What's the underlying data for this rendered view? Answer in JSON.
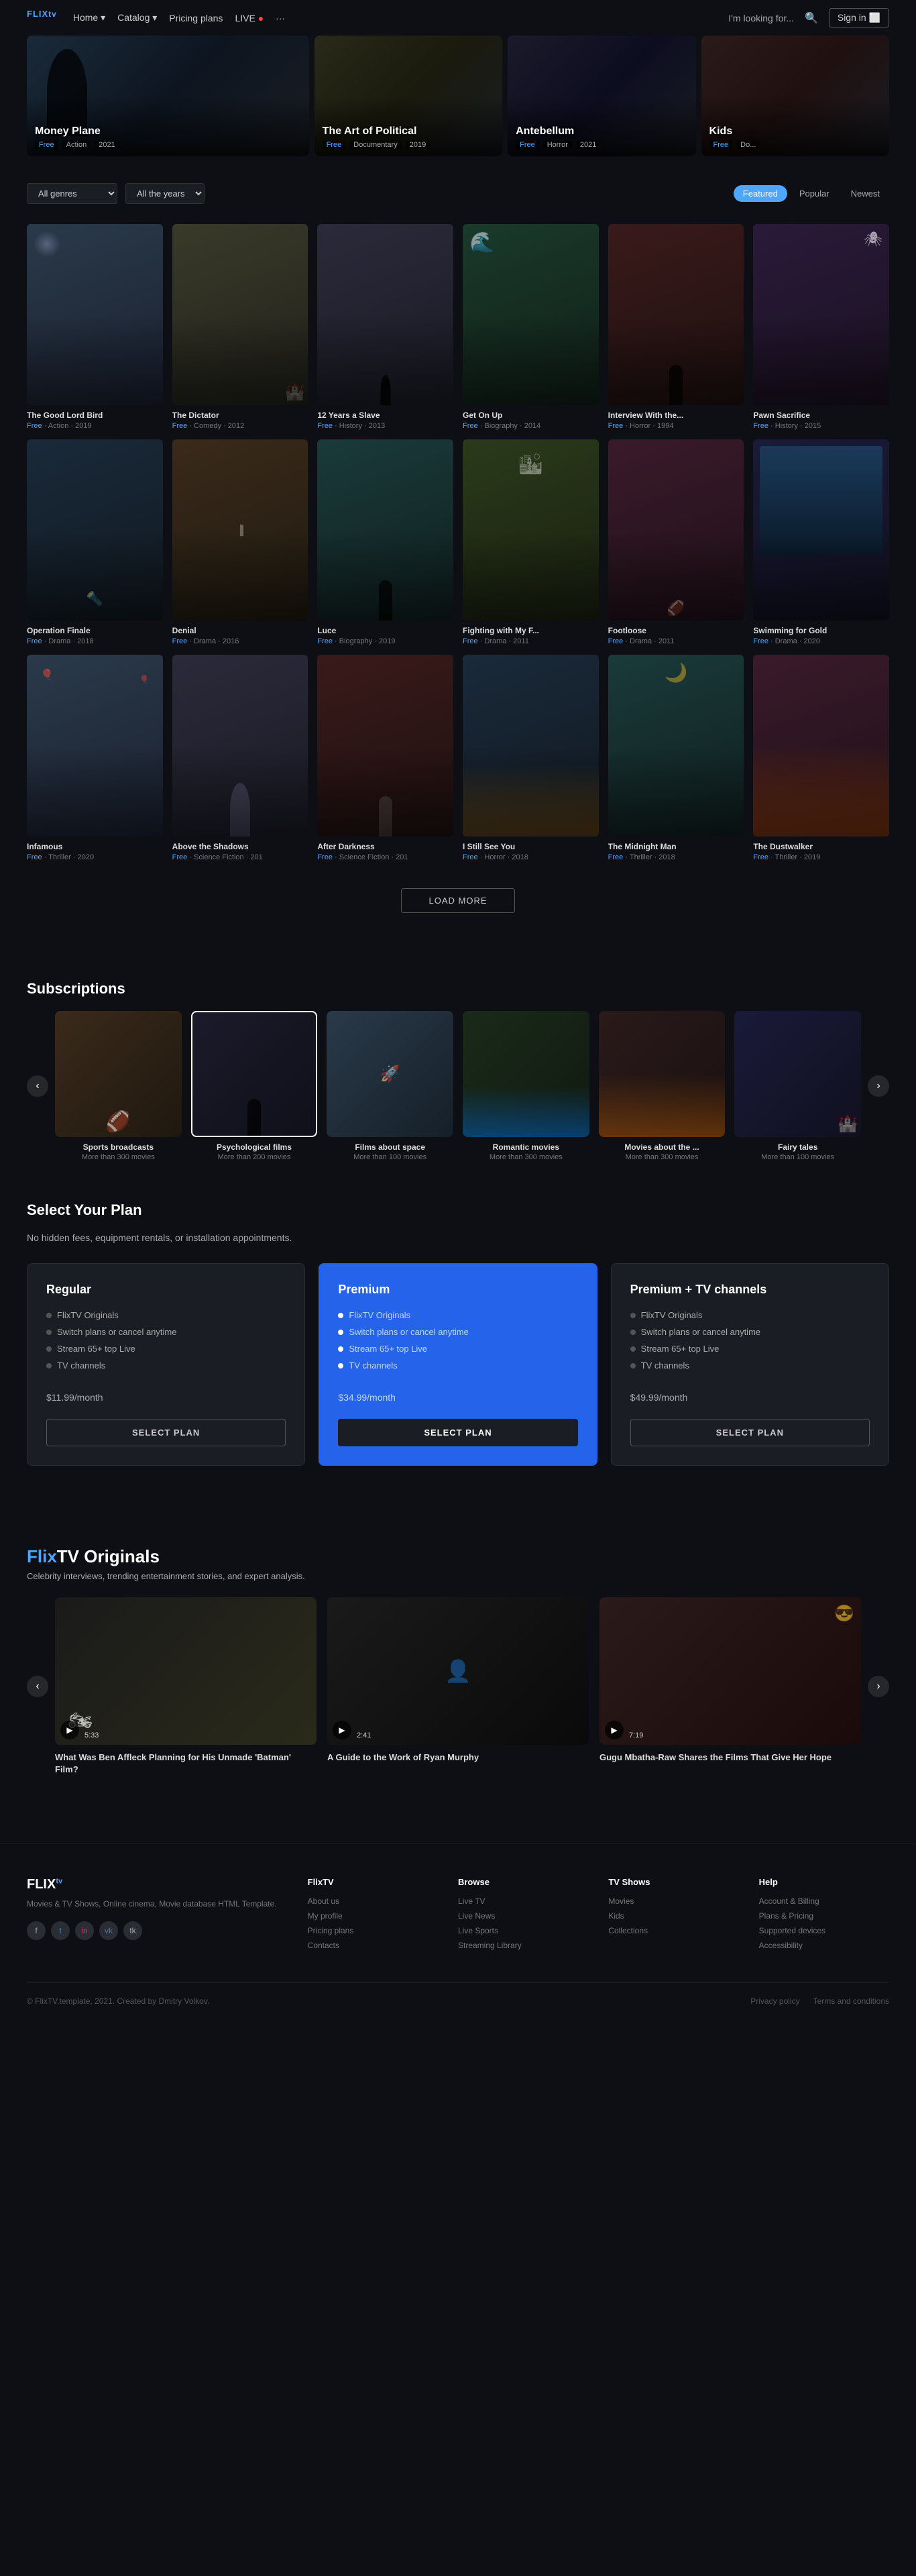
{
  "nav": {
    "logo": "FLIX",
    "logo_sup": "tv",
    "links": [
      "Home",
      "Catalog",
      "Pricing plans",
      "LIVE"
    ],
    "more": "···",
    "search_placeholder": "I'm looking for...",
    "sign_in": "Sign in"
  },
  "hero": {
    "cards": [
      {
        "title": "Money Plane",
        "tags": [
          "Free",
          "Action",
          "2021"
        ],
        "bg": "hero-bg-1"
      },
      {
        "title": "The Art of Political",
        "tags": [
          "Free",
          "Documentary",
          "2019"
        ],
        "bg": "hero-bg-2"
      },
      {
        "title": "Antebellum",
        "tags": [
          "Free",
          "Horror",
          "2021"
        ],
        "bg": "hero-bg-3"
      },
      {
        "title": "Kids",
        "tags": [
          "Free",
          "Do..."
        ],
        "bg": "hero-bg-4"
      }
    ]
  },
  "filters": {
    "genre_label": "All genres",
    "year_label": "All the years",
    "tabs": [
      "Featured",
      "Popular",
      "Newest"
    ],
    "active_tab": "Featured"
  },
  "movies": [
    {
      "title": "The Good Lord Bird",
      "meta": "Free · Action · 2019",
      "thumb": "thumb-1"
    },
    {
      "title": "The Dictator",
      "meta": "Free · Comedy · 2012",
      "thumb": "thumb-2"
    },
    {
      "title": "12 Years a Slave",
      "meta": "Free · History · 2013",
      "thumb": "thumb-3"
    },
    {
      "title": "Get On Up",
      "meta": "Free · Biography · 2014",
      "thumb": "thumb-4"
    },
    {
      "title": "Interview With the...",
      "meta": "Free · Horror · 1994",
      "thumb": "thumb-5"
    },
    {
      "title": "Pawn Sacrifice",
      "meta": "Free · History · 2015",
      "thumb": "thumb-6"
    },
    {
      "title": "Operation Finale",
      "meta": "Free · Drama · 2018",
      "thumb": "thumb-7"
    },
    {
      "title": "Denial",
      "meta": "Free · Drama · 2016",
      "thumb": "thumb-8"
    },
    {
      "title": "Luce",
      "meta": "Free · Biography · 2019",
      "thumb": "thumb-9"
    },
    {
      "title": "Fighting with My F...",
      "meta": "Free · Drama · 2011",
      "thumb": "thumb-10"
    },
    {
      "title": "Footloose",
      "meta": "Free · Drama · 2011",
      "thumb": "thumb-11"
    },
    {
      "title": "Swimming for Gold",
      "meta": "Free · Drama · 2020",
      "thumb": "thumb-12"
    },
    {
      "title": "Infamous",
      "meta": "Free · Thriller · 2020",
      "thumb": "thumb-1"
    },
    {
      "title": "Above the Shadows",
      "meta": "Free · Science Fiction · 201",
      "thumb": "thumb-3"
    },
    {
      "title": "After Darkness",
      "meta": "Free · Science Fiction · 201",
      "thumb": "thumb-5"
    },
    {
      "title": "I Still See You",
      "meta": "Free · Horror · 2018",
      "thumb": "thumb-7"
    },
    {
      "title": "The Midnight Man",
      "meta": "Free · Thriller · 2018",
      "thumb": "thumb-9"
    },
    {
      "title": "The Dustwalker",
      "meta": "Free · Thriller · 2019",
      "thumb": "thumb-11"
    }
  ],
  "load_more": "LOAD MORE",
  "subscriptions": {
    "title": "Subscriptions",
    "items": [
      {
        "title": "Sports broadcasts",
        "count": "More than 300 movies",
        "thumb": "s1"
      },
      {
        "title": "Psychological films",
        "count": "More than 200 movies",
        "thumb": "s2",
        "selected": true
      },
      {
        "title": "Films about space",
        "count": "More than 100 movies",
        "thumb": "s3"
      },
      {
        "title": "Romantic movies",
        "count": "More than 300 movies",
        "thumb": "s4"
      },
      {
        "title": "Movies about the ...",
        "count": "More than 300 movies",
        "thumb": "s5"
      },
      {
        "title": "Fairy tales",
        "count": "More than 100 movies",
        "thumb": "s6"
      }
    ]
  },
  "plans": {
    "title": "Select Your Plan",
    "subtitle": "No hidden fees, equipment rentals, or installation appointments.",
    "cards": [
      {
        "name": "Regular",
        "features": [
          "FlixTV Originals",
          "Switch plans or cancel anytime",
          "Stream 65+ top Live",
          "TV channels"
        ],
        "price": "$11.99",
        "period": "/month",
        "btn": "SELECT PLAN",
        "highlighted": false
      },
      {
        "name": "Premium",
        "features": [
          "FlixTV Originals",
          "Switch plans or cancel anytime",
          "Stream 65+ top Live",
          "TV channels"
        ],
        "price": "$34.99",
        "period": "/month",
        "btn": "SELECT PLAN",
        "highlighted": true
      },
      {
        "name": "Premium + TV channels",
        "features": [
          "FlixTV Originals",
          "Switch plans or cancel anytime",
          "Stream 65+ top Live",
          "TV channels"
        ],
        "price": "$49.99",
        "period": "/month",
        "btn": "SELECT PLAN",
        "highlighted": false
      }
    ]
  },
  "originals": {
    "prefix": "Flix",
    "suffix": "TV Originals",
    "subtitle": "Celebrity interviews, trending entertainment stories, and expert analysis.",
    "items": [
      {
        "title": "What Was Ben Affleck Planning for His Unmade 'Batman' Film?",
        "duration": "5:33",
        "bg": "orig-bg-1"
      },
      {
        "title": "A Guide to the Work of Ryan Murphy",
        "duration": "2:41",
        "bg": "orig-bg-2"
      },
      {
        "title": "Gugu Mbatha-Raw Shares the Films That Give Her Hope",
        "duration": "7:19",
        "bg": "orig-bg-3"
      }
    ]
  },
  "footer": {
    "logo": "FLIX",
    "logo_sup": "tv",
    "desc": "Movies & TV Shows, Online cinema, Movie database HTML Template.",
    "social_icons": [
      "f",
      "t",
      "in",
      "vk",
      "tk"
    ],
    "columns": [
      {
        "title": "FlixTV",
        "links": [
          "About us",
          "My profile",
          "Pricing plans",
          "Contacts"
        ]
      },
      {
        "title": "Browse",
        "links": [
          "Live TV",
          "Live News",
          "Live Sports",
          "Streaming Library"
        ]
      },
      {
        "title": "TV Shows",
        "links": [
          "Movies",
          "Kids",
          "Collections"
        ]
      },
      {
        "title": "Help",
        "links": [
          "Account & Billing",
          "Plans & Pricing",
          "Supported devices",
          "Accessibility"
        ]
      }
    ],
    "copyright": "© FlixTV.template, 2021. Created by Dmitry Volkov.",
    "bottom_links": [
      "Privacy policy",
      "Terms and conditions"
    ]
  }
}
